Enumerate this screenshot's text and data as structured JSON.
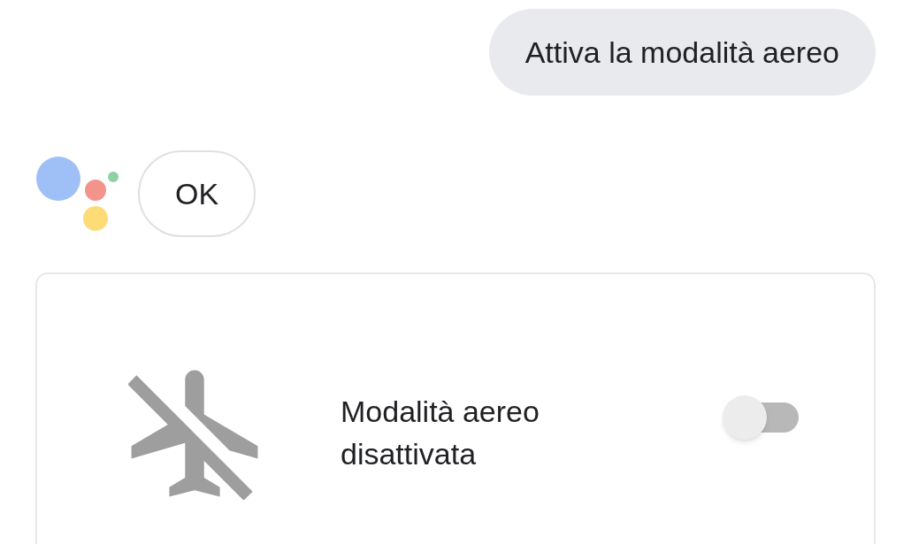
{
  "user_message": "Attiva la modalità aereo",
  "assistant_reply": "OK",
  "card": {
    "label": "Modalità aereo disattivata",
    "toggle": {
      "on": false
    }
  }
}
